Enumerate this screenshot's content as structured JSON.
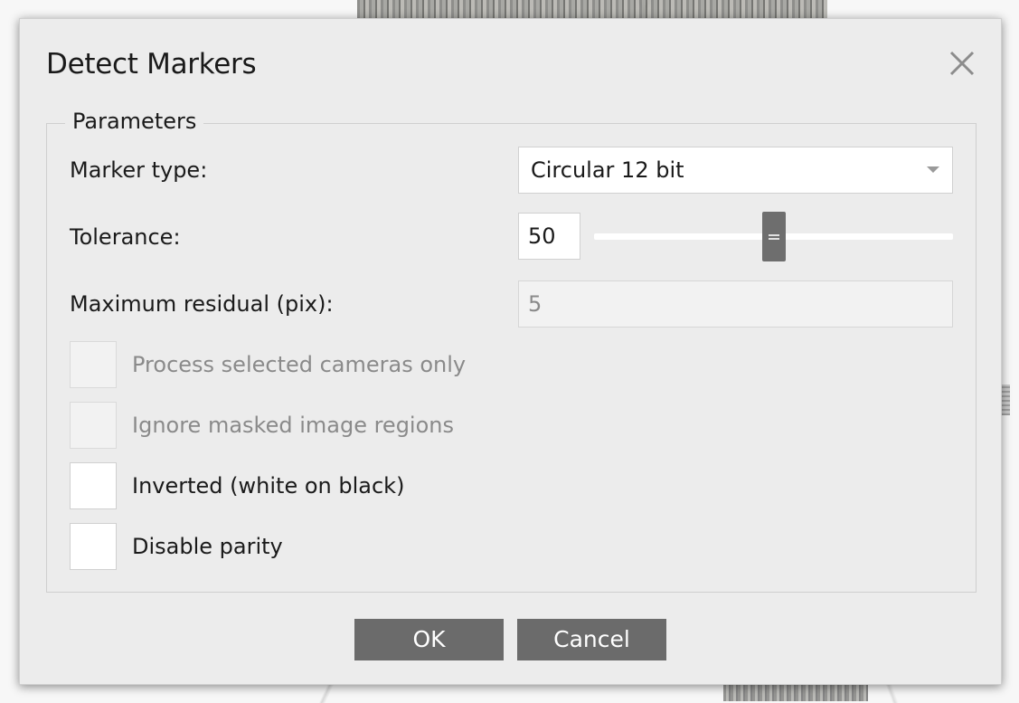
{
  "dialog": {
    "title": "Detect Markers",
    "close_icon": "close-icon"
  },
  "parameters": {
    "legend": "Parameters",
    "marker_type": {
      "label": "Marker type:",
      "value": "Circular 12 bit"
    },
    "tolerance": {
      "label": "Tolerance:",
      "value": "50",
      "slider_level_percent": 50
    },
    "max_residual": {
      "label": "Maximum residual (pix):",
      "value": "5"
    },
    "checkboxes": [
      {
        "label": "Process selected cameras only",
        "checked": false,
        "enabled": false
      },
      {
        "label": "Ignore masked image regions",
        "checked": false,
        "enabled": false
      },
      {
        "label": "Inverted (white on black)",
        "checked": false,
        "enabled": true
      },
      {
        "label": "Disable parity",
        "checked": false,
        "enabled": true
      }
    ]
  },
  "buttons": {
    "ok": "OK",
    "cancel": "Cancel"
  },
  "colors": {
    "dialog_bg": "#ececec",
    "button_bg": "#6b6b6b",
    "disabled_text": "#8a8a8a"
  }
}
